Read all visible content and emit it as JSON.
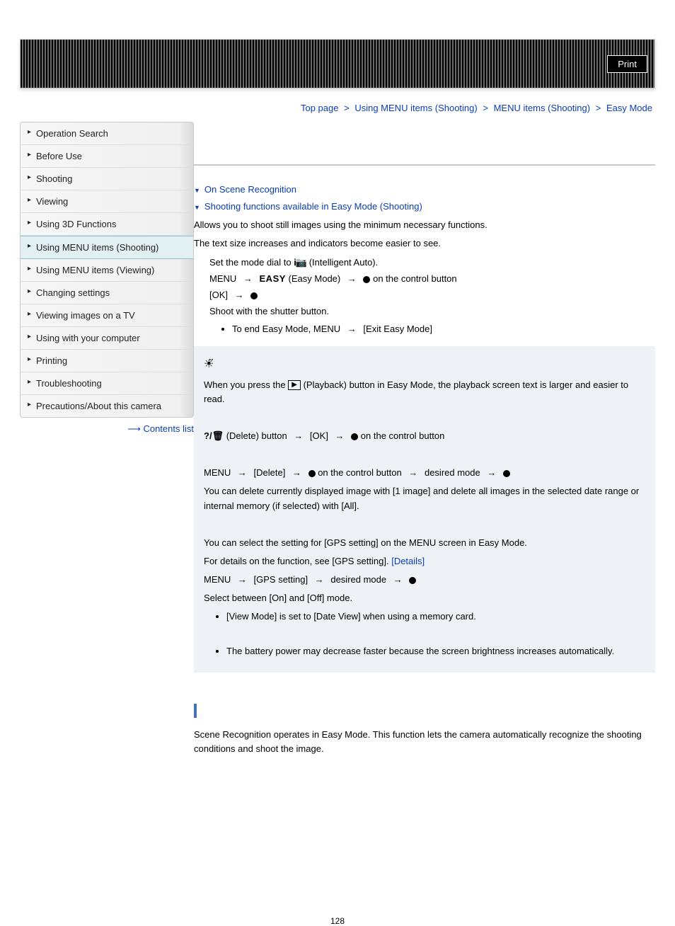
{
  "banner": {
    "print": "Print"
  },
  "breadcrumb": {
    "a": "Top page",
    "b": "Using MENU items (Shooting)",
    "c": "MENU items (Shooting)",
    "d": "Easy Mode"
  },
  "sidebar": {
    "items": [
      "Operation Search",
      "Before Use",
      "Shooting",
      "Viewing",
      "Using 3D Functions",
      "Using MENU items (Shooting)",
      "Using MENU items (Viewing)",
      "Changing settings",
      "Viewing images on a TV",
      "Using with your computer",
      "Printing",
      "Troubleshooting",
      "Precautions/About this camera"
    ],
    "current_index": 5,
    "contents": "Contents list"
  },
  "main": {
    "anchors": {
      "a1": "On Scene Recognition",
      "a2": "Shooting functions available in Easy Mode (Shooting)"
    },
    "intro1": "Allows you to shoot still images using the minimum necessary functions.",
    "intro2": "The text size increases and indicators become easier to see.",
    "step1a": "Set the mode dial to ",
    "step1b": "(Intelligent Auto).",
    "step2a": "MENU ",
    "step2_easy": "(Easy Mode) ",
    "step2b": " on the control button",
    "step3": "[OK] ",
    "step4": "Shoot with the shutter button.",
    "step4_bullet_a": "To end Easy Mode, MENU ",
    "step4_bullet_b": " [Exit Easy Mode]",
    "tip1a": "When you press the ",
    "tip1b": "(Playback) button in Easy Mode, the playback screen text is larger and easier to read.",
    "tip2a": "(Delete) button ",
    "tip2b": " [OK] ",
    "tip2c": " on the control button",
    "tip3a": "MENU ",
    "tip3b": " [Delete] ",
    "tip3c": " on the control button ",
    "tip3d": " desired mode ",
    "tip_long": "You can delete currently displayed image with [1 image] and delete all images in the selected date range or internal memory (if selected) with [All].",
    "gps1": "You can select the setting for [GPS setting] on the MENU screen in Easy Mode.",
    "gps2": "For details on the function, see [GPS setting]. ",
    "gps2_link": "[Details]",
    "gps3a": "MENU ",
    "gps3b": " [GPS setting] ",
    "gps3c": " desired mode ",
    "gps4": "Select between [On] and [Off] mode.",
    "gps_bullet": "[View Mode] is set to [Date View] when using a memory card.",
    "batt_bullet": "The battery power may decrease faster because the screen brightness increases automatically.",
    "scene_text": "Scene Recognition operates in Easy Mode. This function lets the camera automatically recognize the shooting conditions and shoot the image."
  },
  "page_number": "128"
}
